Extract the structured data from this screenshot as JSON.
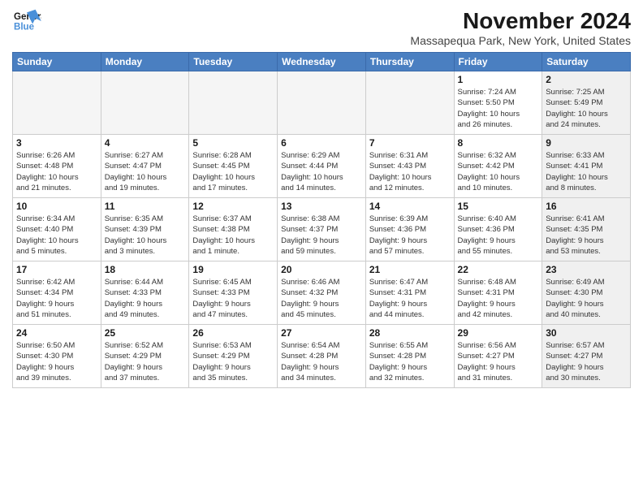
{
  "logo": {
    "line1": "General",
    "line2": "Blue"
  },
  "title": "November 2024",
  "subtitle": "Massapequa Park, New York, United States",
  "weekdays": [
    "Sunday",
    "Monday",
    "Tuesday",
    "Wednesday",
    "Thursday",
    "Friday",
    "Saturday"
  ],
  "weeks": [
    [
      {
        "day": "",
        "info": ""
      },
      {
        "day": "",
        "info": ""
      },
      {
        "day": "",
        "info": ""
      },
      {
        "day": "",
        "info": ""
      },
      {
        "day": "",
        "info": ""
      },
      {
        "day": "1",
        "info": "Sunrise: 7:24 AM\nSunset: 5:50 PM\nDaylight: 10 hours\nand 26 minutes."
      },
      {
        "day": "2",
        "info": "Sunrise: 7:25 AM\nSunset: 5:49 PM\nDaylight: 10 hours\nand 24 minutes."
      }
    ],
    [
      {
        "day": "3",
        "info": "Sunrise: 6:26 AM\nSunset: 4:48 PM\nDaylight: 10 hours\nand 21 minutes."
      },
      {
        "day": "4",
        "info": "Sunrise: 6:27 AM\nSunset: 4:47 PM\nDaylight: 10 hours\nand 19 minutes."
      },
      {
        "day": "5",
        "info": "Sunrise: 6:28 AM\nSunset: 4:45 PM\nDaylight: 10 hours\nand 17 minutes."
      },
      {
        "day": "6",
        "info": "Sunrise: 6:29 AM\nSunset: 4:44 PM\nDaylight: 10 hours\nand 14 minutes."
      },
      {
        "day": "7",
        "info": "Sunrise: 6:31 AM\nSunset: 4:43 PM\nDaylight: 10 hours\nand 12 minutes."
      },
      {
        "day": "8",
        "info": "Sunrise: 6:32 AM\nSunset: 4:42 PM\nDaylight: 10 hours\nand 10 minutes."
      },
      {
        "day": "9",
        "info": "Sunrise: 6:33 AM\nSunset: 4:41 PM\nDaylight: 10 hours\nand 8 minutes."
      }
    ],
    [
      {
        "day": "10",
        "info": "Sunrise: 6:34 AM\nSunset: 4:40 PM\nDaylight: 10 hours\nand 5 minutes."
      },
      {
        "day": "11",
        "info": "Sunrise: 6:35 AM\nSunset: 4:39 PM\nDaylight: 10 hours\nand 3 minutes."
      },
      {
        "day": "12",
        "info": "Sunrise: 6:37 AM\nSunset: 4:38 PM\nDaylight: 10 hours\nand 1 minute."
      },
      {
        "day": "13",
        "info": "Sunrise: 6:38 AM\nSunset: 4:37 PM\nDaylight: 9 hours\nand 59 minutes."
      },
      {
        "day": "14",
        "info": "Sunrise: 6:39 AM\nSunset: 4:36 PM\nDaylight: 9 hours\nand 57 minutes."
      },
      {
        "day": "15",
        "info": "Sunrise: 6:40 AM\nSunset: 4:36 PM\nDaylight: 9 hours\nand 55 minutes."
      },
      {
        "day": "16",
        "info": "Sunrise: 6:41 AM\nSunset: 4:35 PM\nDaylight: 9 hours\nand 53 minutes."
      }
    ],
    [
      {
        "day": "17",
        "info": "Sunrise: 6:42 AM\nSunset: 4:34 PM\nDaylight: 9 hours\nand 51 minutes."
      },
      {
        "day": "18",
        "info": "Sunrise: 6:44 AM\nSunset: 4:33 PM\nDaylight: 9 hours\nand 49 minutes."
      },
      {
        "day": "19",
        "info": "Sunrise: 6:45 AM\nSunset: 4:33 PM\nDaylight: 9 hours\nand 47 minutes."
      },
      {
        "day": "20",
        "info": "Sunrise: 6:46 AM\nSunset: 4:32 PM\nDaylight: 9 hours\nand 45 minutes."
      },
      {
        "day": "21",
        "info": "Sunrise: 6:47 AM\nSunset: 4:31 PM\nDaylight: 9 hours\nand 44 minutes."
      },
      {
        "day": "22",
        "info": "Sunrise: 6:48 AM\nSunset: 4:31 PM\nDaylight: 9 hours\nand 42 minutes."
      },
      {
        "day": "23",
        "info": "Sunrise: 6:49 AM\nSunset: 4:30 PM\nDaylight: 9 hours\nand 40 minutes."
      }
    ],
    [
      {
        "day": "24",
        "info": "Sunrise: 6:50 AM\nSunset: 4:30 PM\nDaylight: 9 hours\nand 39 minutes."
      },
      {
        "day": "25",
        "info": "Sunrise: 6:52 AM\nSunset: 4:29 PM\nDaylight: 9 hours\nand 37 minutes."
      },
      {
        "day": "26",
        "info": "Sunrise: 6:53 AM\nSunset: 4:29 PM\nDaylight: 9 hours\nand 35 minutes."
      },
      {
        "day": "27",
        "info": "Sunrise: 6:54 AM\nSunset: 4:28 PM\nDaylight: 9 hours\nand 34 minutes."
      },
      {
        "day": "28",
        "info": "Sunrise: 6:55 AM\nSunset: 4:28 PM\nDaylight: 9 hours\nand 32 minutes."
      },
      {
        "day": "29",
        "info": "Sunrise: 6:56 AM\nSunset: 4:27 PM\nDaylight: 9 hours\nand 31 minutes."
      },
      {
        "day": "30",
        "info": "Sunrise: 6:57 AM\nSunset: 4:27 PM\nDaylight: 9 hours\nand 30 minutes."
      }
    ]
  ]
}
